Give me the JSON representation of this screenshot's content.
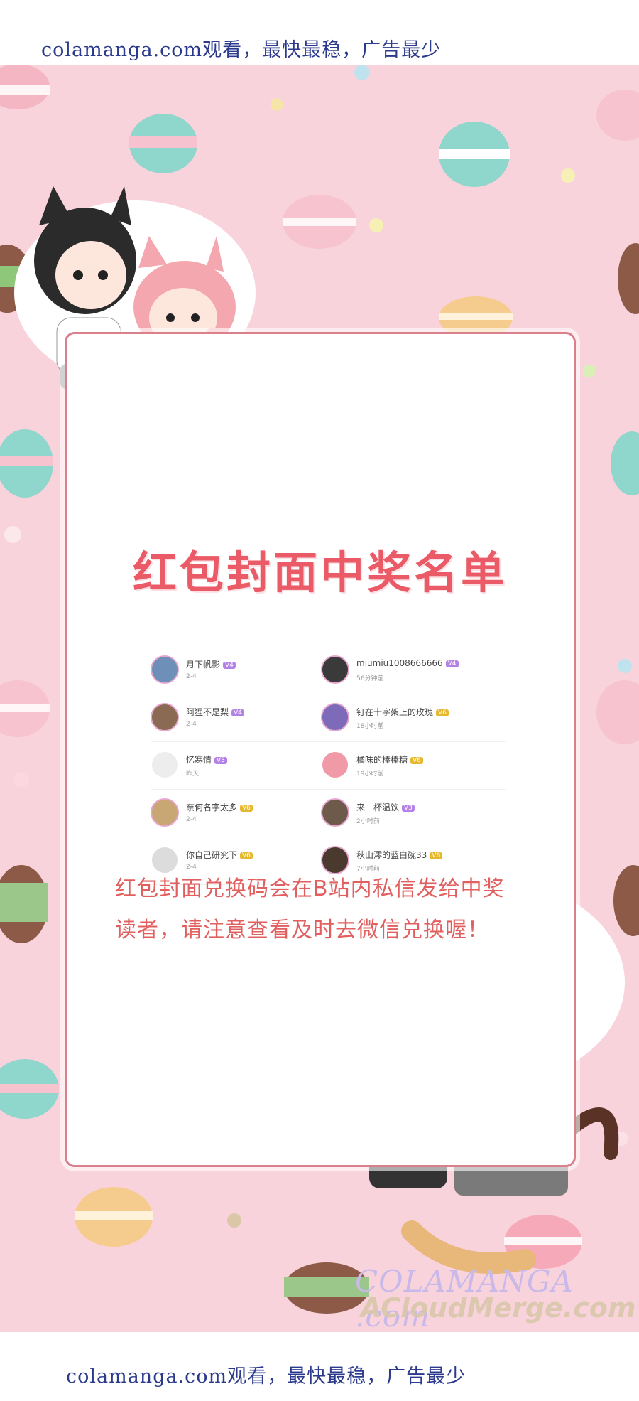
{
  "banner": {
    "top_text": "colamanga.com观看，最快最稳，广告最少",
    "bottom_text": "colamanga.com观看，最快最稳，广告最少"
  },
  "poster": {
    "title": "红包封面中奖名单",
    "notice_line1": "红包封面兑换码会在B站内私信发给中奖",
    "notice_line2": "读者，请注意查看及时去微信兑换喔！"
  },
  "winners_left": [
    {
      "name": "月下帆影",
      "level": "V4",
      "level_color": "purple",
      "time": "2-4"
    },
    {
      "name": "阿狸不是梨",
      "level": "V4",
      "level_color": "purple",
      "time": "2-4"
    },
    {
      "name": "忆寒情",
      "level": "V3",
      "level_color": "purple",
      "time": "昨天"
    },
    {
      "name": "奈何名字太多",
      "level": "V6",
      "level_color": "gold",
      "time": "2-4"
    },
    {
      "name": "你自己研究下",
      "level": "V6",
      "level_color": "gold",
      "time": "2-4"
    }
  ],
  "winners_right": [
    {
      "name": "miumiu1008666666",
      "level": "V4",
      "level_color": "purple",
      "time": "56分钟前"
    },
    {
      "name": "钉在十字架上的玫瑰",
      "level": "V6",
      "level_color": "gold",
      "time": "18小时前"
    },
    {
      "name": "橘味的棒棒糖",
      "level": "V6",
      "level_color": "gold",
      "time": "19小时前"
    },
    {
      "name": "来一杯温饮",
      "level": "V3",
      "level_color": "purple",
      "time": "2小时前"
    },
    {
      "name": "秋山澪的蓝白碗33",
      "level": "V6",
      "level_color": "gold",
      "time": "7小时前"
    }
  ],
  "watermark": {
    "line1": "COLAMANGA .com",
    "line2": "ACloudMerge.com"
  },
  "colors": {
    "background_pink": "#f9d3dc",
    "title_red": "#ea5a67",
    "notice_red": "#e15f5f",
    "banner_text": "#2b3a8c"
  }
}
